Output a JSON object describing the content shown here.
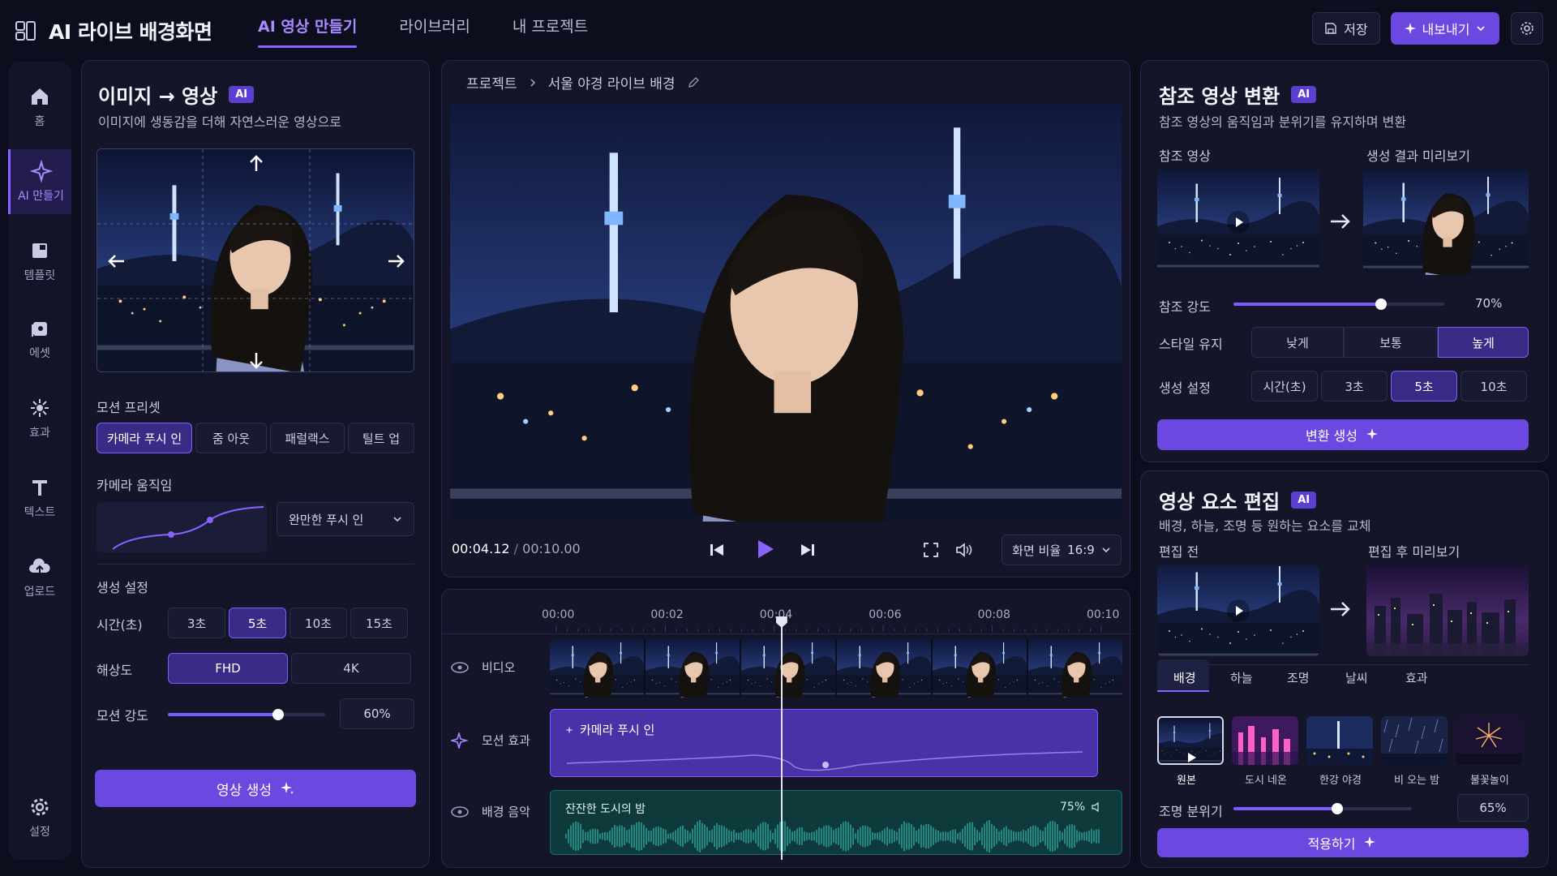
{
  "app": {
    "title": "AI 라이브 배경화면"
  },
  "nav": {
    "tabs": [
      "AI 영상 만들기",
      "라이브러리",
      "내 프로젝트"
    ]
  },
  "toolbar": {
    "save_label": "저장",
    "export_label": "내보내기"
  },
  "sidebar": {
    "items": [
      {
        "label": "홈",
        "icon": "home-icon"
      },
      {
        "label": "AI 만들기",
        "icon": "ai-sparkle-icon"
      },
      {
        "label": "템플릿",
        "icon": "template-icon"
      },
      {
        "label": "에셋",
        "icon": "asset-icon"
      },
      {
        "label": "효과",
        "icon": "effect-icon"
      },
      {
        "label": "텍스트",
        "icon": "text-icon"
      },
      {
        "label": "업로드",
        "icon": "upload-icon"
      },
      {
        "label": "설정",
        "icon": "gear-icon"
      }
    ]
  },
  "left": {
    "title": "이미지 → 영상",
    "ai_badge": "AI",
    "subtitle": "이미지에 생동감을 더해 자연스러운 영상으로",
    "preset_label": "모션 프리셋",
    "presets": [
      "카메라 푸시 인",
      "줌 아웃",
      "패럴랙스",
      "틸트 업"
    ],
    "preset_selected": 0,
    "camera_label": "카메라 움직임",
    "camera_select": "완만한 푸시 인",
    "gen_label": "생성 설정",
    "time_label": "시간(초)",
    "times": [
      "3초",
      "5초",
      "10초",
      "15초"
    ],
    "time_selected": 1,
    "res_label": "해상도",
    "resolutions": [
      "FHD",
      "4K"
    ],
    "res_selected": 0,
    "strength_label": "모션 강도",
    "strength_value": "60%",
    "strength_fraction": 0.7,
    "generate_label": "영상 생성"
  },
  "center": {
    "breadcrumb_root": "프로젝트",
    "breadcrumb_current": "서울 야경 라이브 배경",
    "time_current": "00:04.12",
    "time_sep": "/",
    "time_total": "00:10.00",
    "aspect_label": "화면 비율",
    "aspect_value": "16:9"
  },
  "timeline": {
    "ticks": [
      "00:00",
      "00:02",
      "00:04",
      "00:06",
      "00:08",
      "00:10"
    ],
    "playhead_seconds": 4.12,
    "tracks": [
      {
        "label": "비디오",
        "icon": "eye-icon"
      },
      {
        "label": "모션 효과",
        "icon": "sparkle-icon"
      },
      {
        "label": "배경 음악",
        "icon": "eye-icon"
      }
    ],
    "motion_clip": "카메라 푸시 인",
    "audio_clip": "잔잔한 도시의 밤",
    "audio_volume": "75%"
  },
  "ref": {
    "title": "참조 영상 변환",
    "ai_badge": "AI",
    "subtitle": "참조 영상의 움직임과 분위기를 유지하며 변환",
    "ref_label": "참조 영상",
    "result_label": "생성 결과 미리보기",
    "strength_label": "참조 강도",
    "strength_value": "70%",
    "strength_fraction": 0.7,
    "style_label": "스타일 유지",
    "styles": [
      "낮게",
      "보통",
      "높게"
    ],
    "style_selected": 2,
    "gen_label": "생성 설정",
    "gen_options": [
      "시간(초)",
      "3초",
      "5초",
      "10초"
    ],
    "gen_selected": 2,
    "button_label": "변환 생성"
  },
  "edit": {
    "title": "영상 요소 편집",
    "ai_badge": "AI",
    "subtitle": "배경, 하늘, 조명 등 원하는 요소를 교체",
    "before_label": "편집 전",
    "after_label": "편집 후 미리보기",
    "tabs": [
      "배경",
      "하늘",
      "조명",
      "날씨",
      "효과"
    ],
    "tab_selected": 0,
    "options": [
      "원본",
      "도시 네온",
      "한강 야경",
      "비 오는 밤",
      "불꽃놀이"
    ],
    "option_selected": 0,
    "light_label": "조명 분위기",
    "light_value": "65%",
    "light_fraction": 0.58,
    "apply_label": "적용하기"
  },
  "colors": {
    "accent": "#6b48e0",
    "accent_light": "#a88bff",
    "bg": "#0d0e1d",
    "panel": "#141529"
  }
}
